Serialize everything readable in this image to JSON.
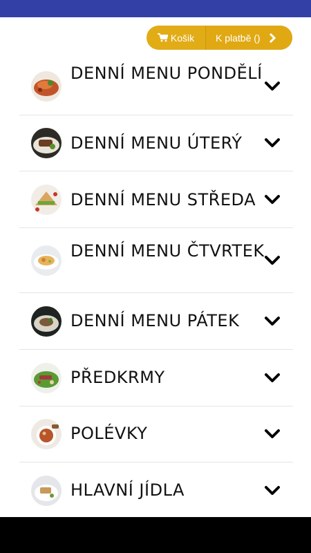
{
  "header": {
    "cart_label": "Košik",
    "checkout_label": "K platbě ()"
  },
  "menu": {
    "items": [
      {
        "label": "DENNÍ MENU PONDĚLÍ",
        "icon": "food-photo-lasagna"
      },
      {
        "label": "DENNÍ MENU ÚTERÝ",
        "icon": "food-photo-steak"
      },
      {
        "label": "DENNÍ MENU STŘEDA",
        "icon": "food-photo-sandwich"
      },
      {
        "label": "DENNÍ MENU ČTVRTEK",
        "icon": "food-photo-soup-bowl"
      },
      {
        "label": "DENNÍ MENU PÁTEK",
        "icon": "food-photo-fish"
      },
      {
        "label": "PŘEDKRMY",
        "icon": "food-photo-salad"
      },
      {
        "label": "POLÉVKY",
        "icon": "food-photo-soup"
      },
      {
        "label": "HLAVNÍ JÍDLA",
        "icon": "food-photo-main-dish"
      }
    ]
  },
  "colors": {
    "topbar": "#3341a6",
    "accent": "#e2ac17",
    "text": "#111111"
  }
}
